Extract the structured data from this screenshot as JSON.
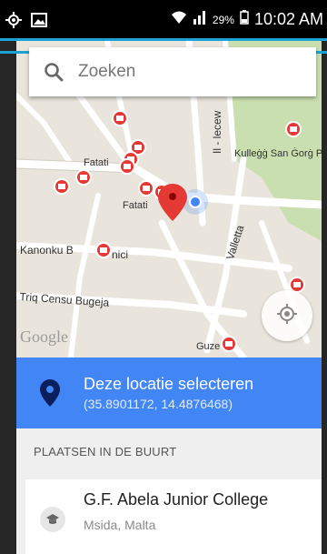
{
  "status_bar": {
    "battery_percent": "29%",
    "time": "10:02 AM",
    "icons": [
      "gps-icon",
      "image-icon",
      "wifi-icon",
      "signal-icon",
      "battery-icon"
    ]
  },
  "search": {
    "placeholder": "Zoeken"
  },
  "map": {
    "labels": {
      "street_lecew": "Il - lecew",
      "kullegg": "Kulleġġ San Ġorġ P",
      "fatati_1": "Fatati",
      "fatati_2": "Fatati",
      "kanonku": "Kanonku B",
      "kanonku_end": "nici",
      "valletta": "Valletta",
      "triq_censu": "Triq Censu Bugeja",
      "guze": "Guze"
    },
    "attribution": "Google",
    "colors": {
      "land": "#e9e5dc",
      "road": "#ffffff",
      "park": "#c9dfb0",
      "marker": "#e53935",
      "user_dot": "#4285f4"
    }
  },
  "select_location": {
    "title": "Deze locatie selecteren",
    "coords": "(35.8901172, 14.4876468)"
  },
  "nearby": {
    "header": "PLAATSEN IN DE BUURT",
    "places": [
      {
        "name": "G.F. Abela Junior College",
        "address": "Msida, Malta",
        "icon": "school-icon"
      }
    ]
  },
  "colors": {
    "accent": "#4285f4",
    "status_line": "#1aa3d4"
  }
}
